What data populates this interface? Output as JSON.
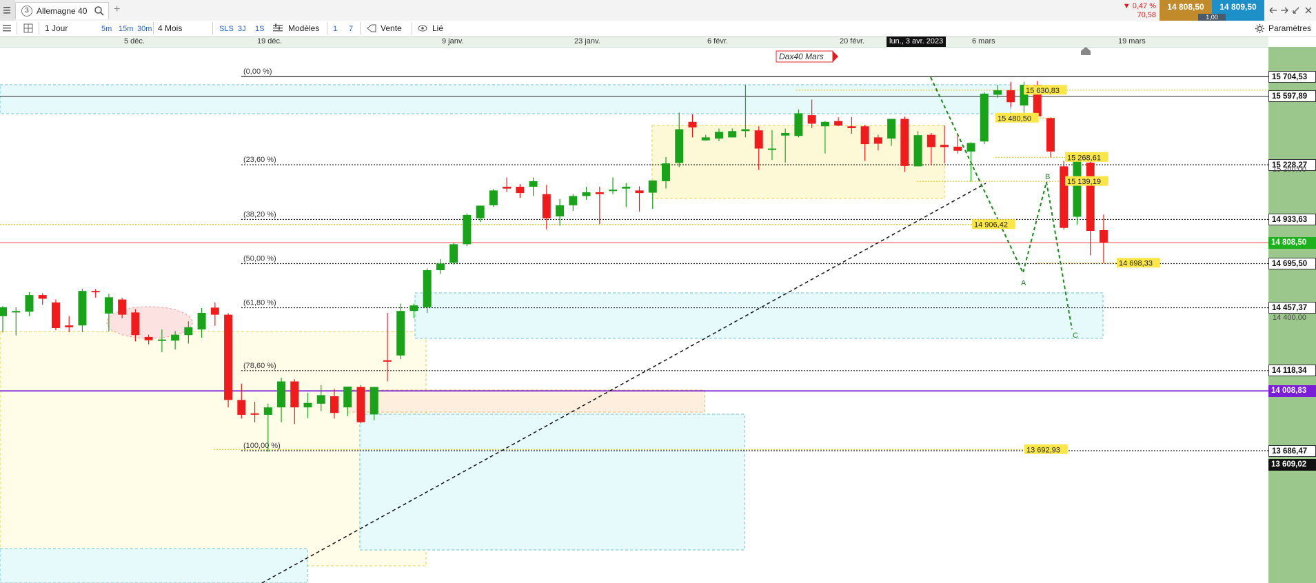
{
  "topbar": {
    "menu_icon": "hamburger-icon",
    "instrument_number": "3",
    "instrument_name": "Allemagne 40",
    "search_icon": "search-icon",
    "add_tab": "+",
    "change_pct": "▼ 0,47 %",
    "change_abs": "70,58",
    "bid": "14 808,50",
    "ask": "14 809,50",
    "spread": "1,00",
    "window_icons": [
      "back-arrow-icon",
      "forward-arrow-icon",
      "shrink-icon",
      "close-icon"
    ]
  },
  "toolbar": {
    "period": "1 Jour",
    "intervals": [
      "5m",
      "15m",
      "30m"
    ],
    "range": "4 Mois",
    "modes": [
      "SLS",
      "3J",
      "1S"
    ],
    "models": "Modèles",
    "counts": [
      "1",
      "7"
    ],
    "sell": "Vente",
    "linked": "Lié",
    "settings": "Paramètres"
  },
  "dates": {
    "labels": [
      "5 déc.",
      "19 déc.",
      "9 janv.",
      "23 janv.",
      "6 févr.",
      "20 févr.",
      "6 mars",
      "19 mars"
    ],
    "cursor": "lun., 3 avr. 2023"
  },
  "colors": {
    "up": "#1aa31a",
    "down": "#ee1c1c",
    "price_tag_green": "#1db21d",
    "purple": "#7a1fd6",
    "bid_bg": "#c18a2a",
    "ask_bg": "#1e90c8",
    "axis_bg": "#9cc78c"
  },
  "chart_data": {
    "type": "candlestick",
    "title": "Dax40 Mars",
    "ylim": [
      13609.02,
      15850
    ],
    "price_labels": [
      {
        "value": "15 704,53",
        "kind": "level"
      },
      {
        "value": "15 597,89",
        "kind": "level"
      },
      {
        "value": "15 228,27",
        "kind": "level"
      },
      {
        "value": "15 200,00",
        "kind": "grid"
      },
      {
        "value": "14 933,63",
        "kind": "level"
      },
      {
        "value": "14 808,50",
        "kind": "current"
      },
      {
        "value": "14 695,50",
        "kind": "level"
      },
      {
        "value": "14 457,37",
        "kind": "level"
      },
      {
        "value": "14 400,00",
        "kind": "grid"
      },
      {
        "value": "14 118,34",
        "kind": "level"
      },
      {
        "value": "14 008,83",
        "kind": "purple"
      },
      {
        "value": "13 686,47",
        "kind": "level"
      },
      {
        "value": "13 609,02",
        "kind": "bottom"
      }
    ],
    "fibonacci": [
      {
        "label": "(0,00 %)",
        "price": 15704.53
      },
      {
        "label": "(23,60 %)",
        "price": 15228.27
      },
      {
        "label": "(38,20 %)",
        "price": 14933.63
      },
      {
        "label": "(50,00 %)",
        "price": 14695.5
      },
      {
        "label": "(61,80 %)",
        "price": 14457.37
      },
      {
        "label": "(78,60 %)",
        "price": 14118.34
      },
      {
        "label": "(100,00 %)",
        "price": 13686.47
      }
    ],
    "annotations": [
      {
        "text": "15 630,83",
        "price": 15630.83
      },
      {
        "text": "15 480,50",
        "price": 15480.5
      },
      {
        "text": "15 268,61",
        "price": 15268.61
      },
      {
        "text": "15 139,19",
        "price": 15139.19
      },
      {
        "text": "14 906,42",
        "price": 14906.42
      },
      {
        "text": "14 698,33",
        "price": 14698.33
      },
      {
        "text": "13 692,93",
        "price": 13692.93
      }
    ],
    "wave_labels": [
      "A",
      "B",
      "C"
    ],
    "candles": [
      {
        "o": 14412,
        "h": 14466,
        "l": 14324,
        "c": 14460
      },
      {
        "o": 14432,
        "h": 14460,
        "l": 14308,
        "c": 14440
      },
      {
        "o": 14436,
        "h": 14542,
        "l": 14412,
        "c": 14526
      },
      {
        "o": 14526,
        "h": 14536,
        "l": 14474,
        "c": 14506
      },
      {
        "o": 14486,
        "h": 14502,
        "l": 14336,
        "c": 14348
      },
      {
        "o": 14362,
        "h": 14412,
        "l": 14325,
        "c": 14352
      },
      {
        "o": 14362,
        "h": 14560,
        "l": 14326,
        "c": 14548
      },
      {
        "o": 14548,
        "h": 14558,
        "l": 14512,
        "c": 14542
      },
      {
        "o": 14426,
        "h": 14532,
        "l": 14330,
        "c": 14514
      },
      {
        "o": 14502,
        "h": 14512,
        "l": 14400,
        "c": 14420
      },
      {
        "o": 14432,
        "h": 14450,
        "l": 14276,
        "c": 14310
      },
      {
        "o": 14300,
        "h": 14312,
        "l": 14260,
        "c": 14282
      },
      {
        "o": 14280,
        "h": 14340,
        "l": 14218,
        "c": 14286
      },
      {
        "o": 14280,
        "h": 14332,
        "l": 14232,
        "c": 14312
      },
      {
        "o": 14310,
        "h": 14384,
        "l": 14264,
        "c": 14352
      },
      {
        "o": 14340,
        "h": 14456,
        "l": 14296,
        "c": 14430
      },
      {
        "o": 14458,
        "h": 14486,
        "l": 14360,
        "c": 14420
      },
      {
        "o": 14420,
        "h": 14428,
        "l": 13920,
        "c": 13960
      },
      {
        "o": 13960,
        "h": 14048,
        "l": 13860,
        "c": 13880
      },
      {
        "o": 13888,
        "h": 13950,
        "l": 13840,
        "c": 13882
      },
      {
        "o": 13880,
        "h": 13940,
        "l": 13680,
        "c": 13920
      },
      {
        "o": 13920,
        "h": 14080,
        "l": 13840,
        "c": 14060
      },
      {
        "o": 14060,
        "h": 14072,
        "l": 13830,
        "c": 13920
      },
      {
        "o": 13920,
        "h": 13998,
        "l": 13862,
        "c": 13944
      },
      {
        "o": 13940,
        "h": 14040,
        "l": 13900,
        "c": 13986
      },
      {
        "o": 13980,
        "h": 14020,
        "l": 13860,
        "c": 13890
      },
      {
        "o": 13920,
        "h": 14012,
        "l": 13872,
        "c": 14032
      },
      {
        "o": 14030,
        "h": 14040,
        "l": 13834,
        "c": 13840
      },
      {
        "o": 13882,
        "h": 14030,
        "l": 13850,
        "c": 14030
      },
      {
        "o": 14174,
        "h": 14430,
        "l": 14060,
        "c": 14170
      },
      {
        "o": 14200,
        "h": 14480,
        "l": 14180,
        "c": 14440
      },
      {
        "o": 14440,
        "h": 14480,
        "l": 14400,
        "c": 14470
      },
      {
        "o": 14460,
        "h": 14670,
        "l": 14430,
        "c": 14660
      },
      {
        "o": 14660,
        "h": 14720,
        "l": 14640,
        "c": 14696
      },
      {
        "o": 14700,
        "h": 14808,
        "l": 14690,
        "c": 14800
      },
      {
        "o": 14800,
        "h": 14966,
        "l": 14790,
        "c": 14958
      },
      {
        "o": 14940,
        "h": 15008,
        "l": 14920,
        "c": 15008
      },
      {
        "o": 15010,
        "h": 15098,
        "l": 15000,
        "c": 15090
      },
      {
        "o": 15110,
        "h": 15160,
        "l": 15082,
        "c": 15100
      },
      {
        "o": 15110,
        "h": 15124,
        "l": 15050,
        "c": 15076
      },
      {
        "o": 15110,
        "h": 15160,
        "l": 15060,
        "c": 15140
      },
      {
        "o": 15070,
        "h": 15120,
        "l": 14880,
        "c": 14940
      },
      {
        "o": 14950,
        "h": 15044,
        "l": 14900,
        "c": 15010
      },
      {
        "o": 15010,
        "h": 15070,
        "l": 14980,
        "c": 15060
      },
      {
        "o": 15060,
        "h": 15110,
        "l": 15040,
        "c": 15080
      },
      {
        "o": 15080,
        "h": 15110,
        "l": 14908,
        "c": 15070
      },
      {
        "o": 15090,
        "h": 15160,
        "l": 15070,
        "c": 15094
      },
      {
        "o": 15100,
        "h": 15130,
        "l": 15000,
        "c": 15110
      },
      {
        "o": 15090,
        "h": 15112,
        "l": 14976,
        "c": 15076
      },
      {
        "o": 15078,
        "h": 15140,
        "l": 14990,
        "c": 15144
      },
      {
        "o": 15140,
        "h": 15270,
        "l": 15100,
        "c": 15236
      },
      {
        "o": 15238,
        "h": 15510,
        "l": 15216,
        "c": 15420
      },
      {
        "o": 15460,
        "h": 15500,
        "l": 15376,
        "c": 15430
      },
      {
        "o": 15360,
        "h": 15390,
        "l": 15360,
        "c": 15376
      },
      {
        "o": 15370,
        "h": 15424,
        "l": 15356,
        "c": 15406
      },
      {
        "o": 15376,
        "h": 15424,
        "l": 15376,
        "c": 15410
      },
      {
        "o": 15410,
        "h": 15660,
        "l": 15376,
        "c": 15420
      },
      {
        "o": 15414,
        "h": 15436,
        "l": 15200,
        "c": 15316
      },
      {
        "o": 15314,
        "h": 15416,
        "l": 15254,
        "c": 15316
      },
      {
        "o": 15386,
        "h": 15424,
        "l": 15240,
        "c": 15400
      },
      {
        "o": 15384,
        "h": 15526,
        "l": 15376,
        "c": 15506
      },
      {
        "o": 15496,
        "h": 15580,
        "l": 15426,
        "c": 15450
      },
      {
        "o": 15436,
        "h": 15464,
        "l": 15290,
        "c": 15460
      },
      {
        "o": 15464,
        "h": 15484,
        "l": 15436,
        "c": 15440
      },
      {
        "o": 15436,
        "h": 15486,
        "l": 15396,
        "c": 15426
      },
      {
        "o": 15436,
        "h": 15444,
        "l": 15250,
        "c": 15340
      },
      {
        "o": 15376,
        "h": 15390,
        "l": 15306,
        "c": 15342
      },
      {
        "o": 15370,
        "h": 15432,
        "l": 15330,
        "c": 15476
      },
      {
        "o": 15476,
        "h": 15488,
        "l": 15190,
        "c": 15222
      },
      {
        "o": 15220,
        "h": 15410,
        "l": 15220,
        "c": 15388
      },
      {
        "o": 15390,
        "h": 15400,
        "l": 15230,
        "c": 15324
      },
      {
        "o": 15336,
        "h": 15440,
        "l": 15236,
        "c": 15324
      },
      {
        "o": 15326,
        "h": 15392,
        "l": 15290,
        "c": 15304
      },
      {
        "o": 15300,
        "h": 15350,
        "l": 15138,
        "c": 15346
      },
      {
        "o": 15354,
        "h": 15620,
        "l": 15340,
        "c": 15612
      },
      {
        "o": 15606,
        "h": 15660,
        "l": 15590,
        "c": 15630
      },
      {
        "o": 15630,
        "h": 15676,
        "l": 15540,
        "c": 15566
      },
      {
        "o": 15548,
        "h": 15676,
        "l": 15500,
        "c": 15660
      },
      {
        "o": 15660,
        "h": 15680,
        "l": 15480,
        "c": 15490
      },
      {
        "o": 15480,
        "h": 15484,
        "l": 15268,
        "c": 15300
      },
      {
        "o": 15220,
        "h": 15250,
        "l": 14880,
        "c": 14888
      },
      {
        "o": 14948,
        "h": 15268,
        "l": 14906,
        "c": 15256
      },
      {
        "o": 15240,
        "h": 15250,
        "l": 14740,
        "c": 14872
      },
      {
        "o": 14876,
        "h": 14960,
        "l": 14698,
        "c": 14810
      }
    ]
  }
}
